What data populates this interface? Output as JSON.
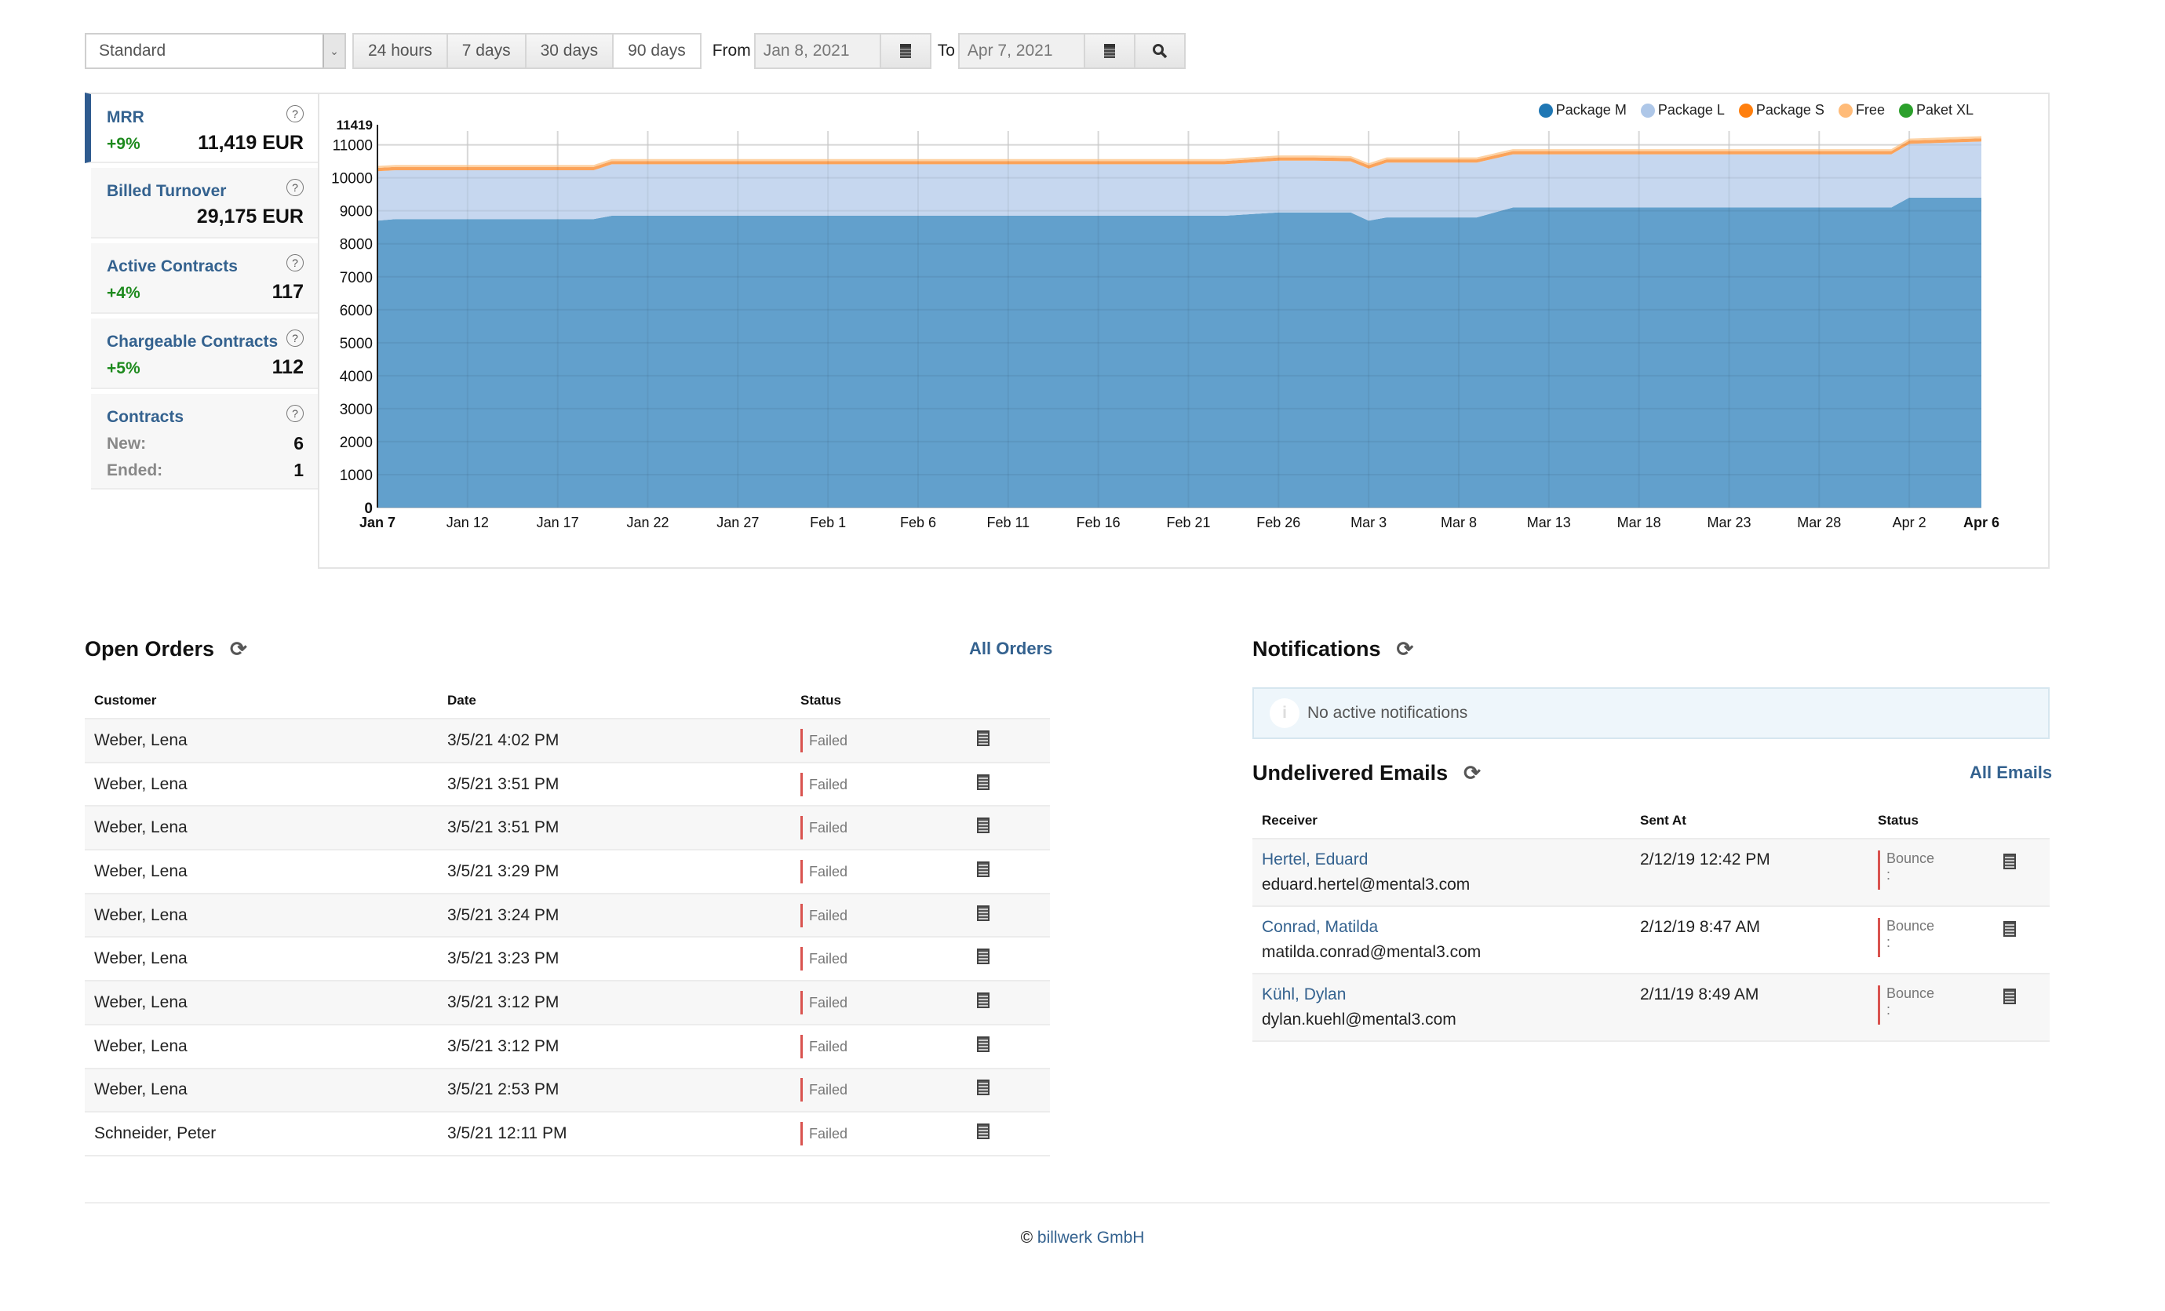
{
  "toolbar": {
    "view_select": "Standard",
    "ranges": [
      "24 hours",
      "7 days",
      "30 days",
      "90 days"
    ],
    "active_range": "90 days",
    "from_label": "From",
    "from_value": "Jan 8, 2021",
    "to_label": "To",
    "to_value": "Apr 7, 2021"
  },
  "kpis": [
    {
      "title": "MRR",
      "change": "+9%",
      "value": "11,419 EUR",
      "active": true
    },
    {
      "title": "Billed Turnover",
      "change": "",
      "value": "29,175 EUR"
    },
    {
      "title": "Active Contracts",
      "change": "+4%",
      "value": "117"
    },
    {
      "title": "Chargeable Contracts",
      "change": "+5%",
      "value": "112"
    },
    {
      "title": "Contracts",
      "new_label": "New:",
      "new_value": "6",
      "ended_label": "Ended:",
      "ended_value": "1"
    }
  ],
  "help_glyph": "?",
  "chart_data": {
    "type": "area",
    "stacked": true,
    "title": "",
    "xlabel": "",
    "ylabel": "",
    "ylim": [
      0,
      11419
    ],
    "y_ticks": [
      "0",
      "1000",
      "2000",
      "3000",
      "4000",
      "5000",
      "6000",
      "7000",
      "8000",
      "9000",
      "10000",
      "11000",
      "11419"
    ],
    "x_ticks": [
      "Jan 7",
      "Jan 12",
      "Jan 17",
      "Jan 22",
      "Jan 27",
      "Feb 1",
      "Feb 6",
      "Feb 11",
      "Feb 16",
      "Feb 21",
      "Feb 26",
      "Mar 3",
      "Mar 8",
      "Mar 13",
      "Mar 18",
      "Mar 23",
      "Mar 28",
      "Apr 2",
      "Apr 6"
    ],
    "x_days": [
      0,
      1,
      12,
      13,
      35,
      36,
      37,
      47,
      50,
      52,
      54,
      55,
      56,
      61,
      63,
      64,
      84,
      85,
      89
    ],
    "legend_position": "top-right",
    "grid": true,
    "series": [
      {
        "name": "Package M",
        "color": "#1f77b4",
        "fill": "#62a0cc",
        "values": [
          8700,
          8750,
          8750,
          8850,
          8850,
          8850,
          8850,
          8850,
          8950,
          8950,
          8950,
          8700,
          8800,
          8800,
          9100,
          9100,
          9100,
          9400,
          9400
        ]
      },
      {
        "name": "Package L",
        "color": "#aec7e8",
        "fill": "#c6d7ef",
        "values": [
          1500,
          1480,
          1480,
          1560,
          1560,
          1560,
          1560,
          1560,
          1570,
          1570,
          1550,
          1580,
          1660,
          1660,
          1610,
          1610,
          1610,
          1630,
          1700
        ]
      },
      {
        "name": "Package S",
        "color": "#ff7f0e",
        "fill": "#fba35a",
        "values": [
          100,
          100,
          100,
          100,
          100,
          100,
          100,
          100,
          100,
          100,
          100,
          100,
          100,
          100,
          100,
          100,
          100,
          100,
          100
        ]
      },
      {
        "name": "Free",
        "color": "#ffbb78",
        "fill": "#fdd2a4",
        "values": [
          60,
          60,
          60,
          60,
          60,
          60,
          60,
          60,
          60,
          60,
          60,
          60,
          60,
          60,
          60,
          60,
          60,
          60,
          60
        ]
      },
      {
        "name": "Paket XL",
        "color": "#2ca02c",
        "fill": "#2ca02c",
        "values": [
          0,
          0,
          0,
          0,
          0,
          0,
          0,
          0,
          0,
          0,
          0,
          0,
          0,
          0,
          0,
          0,
          0,
          0,
          0
        ]
      }
    ]
  },
  "open_orders": {
    "title": "Open Orders",
    "all_link": "All Orders",
    "columns": [
      "Customer",
      "Date",
      "Status"
    ],
    "rows": [
      {
        "customer": "Weber, Lena",
        "date": "3/5/21 4:02 PM",
        "status": "Failed"
      },
      {
        "customer": "Weber, Lena",
        "date": "3/5/21 3:51 PM",
        "status": "Failed"
      },
      {
        "customer": "Weber, Lena",
        "date": "3/5/21 3:51 PM",
        "status": "Failed"
      },
      {
        "customer": "Weber, Lena",
        "date": "3/5/21 3:29 PM",
        "status": "Failed"
      },
      {
        "customer": "Weber, Lena",
        "date": "3/5/21 3:24 PM",
        "status": "Failed"
      },
      {
        "customer": "Weber, Lena",
        "date": "3/5/21 3:23 PM",
        "status": "Failed"
      },
      {
        "customer": "Weber, Lena",
        "date": "3/5/21 3:12 PM",
        "status": "Failed"
      },
      {
        "customer": "Weber, Lena",
        "date": "3/5/21 3:12 PM",
        "status": "Failed"
      },
      {
        "customer": "Weber, Lena",
        "date": "3/5/21 2:53 PM",
        "status": "Failed"
      },
      {
        "customer": "Schneider, Peter",
        "date": "3/5/21 12:11 PM",
        "status": "Failed"
      }
    ]
  },
  "notifications": {
    "title": "Notifications",
    "empty_text": "No active notifications",
    "info_glyph": "i"
  },
  "undelivered_emails": {
    "title": "Undelivered Emails",
    "all_link": "All Emails",
    "columns": [
      "Receiver",
      "Sent At",
      "Status"
    ],
    "rows": [
      {
        "name": "Hertel, Eduard",
        "email": "eduard.hertel@mental3.com",
        "sent_at": "2/12/19 12:42 PM",
        "status": "Bounce",
        "status_detail": ":"
      },
      {
        "name": "Conrad, Matilda",
        "email": "matilda.conrad@mental3.com",
        "sent_at": "2/12/19 8:47 AM",
        "status": "Bounce",
        "status_detail": ":"
      },
      {
        "name": "Kühl, Dylan",
        "email": "dylan.kuehl@mental3.com",
        "sent_at": "2/11/19 8:49 AM",
        "status": "Bounce",
        "status_detail": ":"
      }
    ]
  },
  "footer": {
    "copyright": "©",
    "company": "billwerk GmbH"
  },
  "icons": {
    "refresh": "⟳",
    "search": "⚲",
    "caret": "⌄"
  }
}
